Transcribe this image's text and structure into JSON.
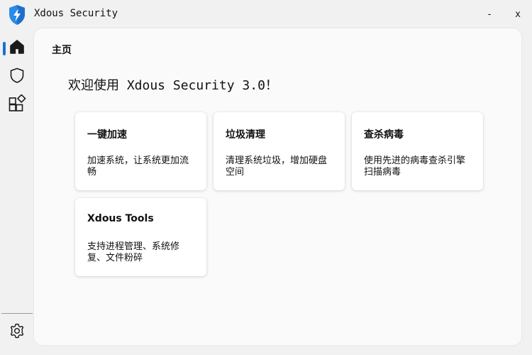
{
  "app": {
    "title": "Xdous Security",
    "logo_icon": "shield-lightning-icon",
    "accent": "#1f6fd0"
  },
  "window_controls": {
    "minimize_label": "-",
    "close_label": "x"
  },
  "sidebar": {
    "items": [
      {
        "name": "home",
        "icon": "home-icon",
        "active": true
      },
      {
        "name": "protection",
        "icon": "shield-icon",
        "active": false
      },
      {
        "name": "tools",
        "icon": "apps-icon",
        "active": false
      }
    ],
    "footer_item": {
      "name": "settings",
      "icon": "gear-icon"
    }
  },
  "main": {
    "page_title": "主页",
    "welcome": "欢迎使用 Xdous Security 3.0！",
    "cards": [
      {
        "title": "一键加速",
        "desc": "加速系统，让系统更加流畅"
      },
      {
        "title": "垃圾清理",
        "desc": "清理系统垃圾，增加硬盘空间"
      },
      {
        "title": "查杀病毒",
        "desc": "使用先进的病毒查杀引擎扫描病毒"
      },
      {
        "title": "Xdous Tools",
        "desc": "支持进程管理、系统修复、文件粉碎"
      }
    ]
  }
}
